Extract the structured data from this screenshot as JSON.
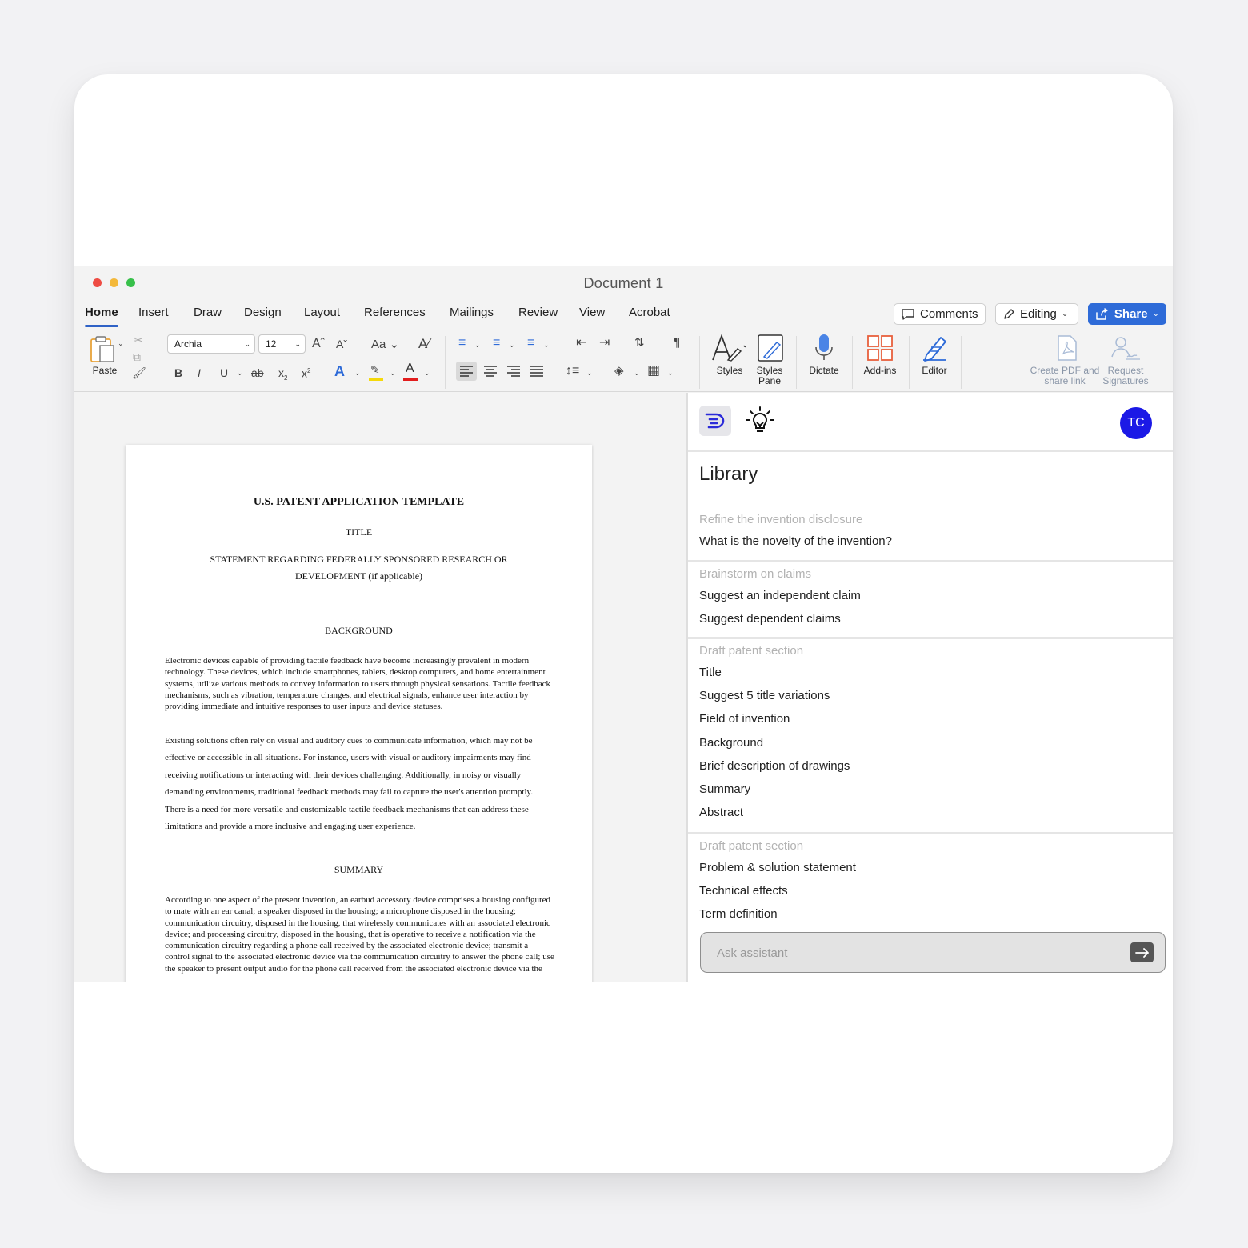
{
  "window": {
    "title": "Document 1"
  },
  "tabs": [
    {
      "label": "Home"
    },
    {
      "label": "Insert"
    },
    {
      "label": "Draw"
    },
    {
      "label": "Design"
    },
    {
      "label": "Layout"
    },
    {
      "label": "References"
    },
    {
      "label": "Mailings"
    },
    {
      "label": "Review"
    },
    {
      "label": "View"
    },
    {
      "label": "Acrobat"
    }
  ],
  "topbar": {
    "comments": "Comments",
    "editing": "Editing",
    "share": "Share"
  },
  "ribbon": {
    "paste": "Paste",
    "font_name": "Archia",
    "font_size": "12",
    "styles": "Styles",
    "styles_pane": "Styles Pane",
    "dictate": "Dictate",
    "addins": "Add-ins",
    "editor": "Editor",
    "create_pdf": "Create PDF and share link",
    "request_sig": "Request Signatures",
    "colors": {
      "highlight": "#f5d90a",
      "font_color": "#e21d1d",
      "accent": "#2e6bd8",
      "addins": "#e8603c"
    }
  },
  "document": {
    "title": "U.S. PATENT APPLICATION TEMPLATE",
    "subtitle": "TITLE",
    "statement": "STATEMENT REGARDING FEDERALLY SPONSORED RESEARCH OR DEVELOPMENT (if applicable)",
    "background_heading": "BACKGROUND",
    "para1": "Electronic devices capable of providing tactile feedback have become increasingly prevalent in modern technology. These devices, which include smartphones, tablets, desktop computers, and home entertainment systems, utilize various methods to convey information to users through physical sensations. Tactile feedback mechanisms, such as vibration, temperature changes, and electrical signals, enhance user interaction by providing immediate and intuitive responses to user inputs and device statuses.",
    "para2": "Existing solutions often rely on visual and auditory cues to communicate information, which may not be effective or accessible in all situations. For instance, users with visual or auditory impairments may find receiving notifications or interacting with their devices challenging. Additionally, in noisy or visually demanding environments, traditional feedback methods may fail to capture the user's attention promptly. There is a need for more versatile and customizable tactile feedback mechanisms that can address these limitations and provide a more inclusive and engaging user experience.",
    "summary_heading": "SUMMARY",
    "para3": "According to one aspect of the present invention, an earbud accessory device comprises a housing configured to mate with an ear canal; a speaker disposed in the housing; a microphone disposed in the housing; communication circuitry, disposed in the housing, that wirelessly communicates with an associated electronic device; and processing circuitry, disposed in the housing, that is operative to receive a notification via the communication circuitry regarding a phone call received by the associated electronic device; transmit a control signal to the associated electronic device via the communication circuitry to answer the phone call; use the speaker to present output audio for the phone call received from the associated electronic device via the"
  },
  "panel": {
    "avatar_initials": "TC",
    "library_title": "Library",
    "sections": [
      {
        "heading": "Refine the invention disclosure",
        "items": [
          "What is the novelty of the invention?"
        ]
      },
      {
        "heading": "Brainstorm on claims",
        "items": [
          "Suggest an independent claim",
          "Suggest dependent claims"
        ]
      },
      {
        "heading": "Draft patent section",
        "items": [
          "Title",
          "Suggest 5 title variations",
          "Field of invention",
          "Background",
          "Brief description of drawings",
          "Summary",
          "Abstract"
        ]
      },
      {
        "heading": "Draft patent section",
        "items": [
          "Problem & solution statement",
          "Technical effects",
          "Term definition"
        ]
      }
    ],
    "ask_placeholder": "Ask assistant",
    "avatar_color": "#1b19e6"
  }
}
